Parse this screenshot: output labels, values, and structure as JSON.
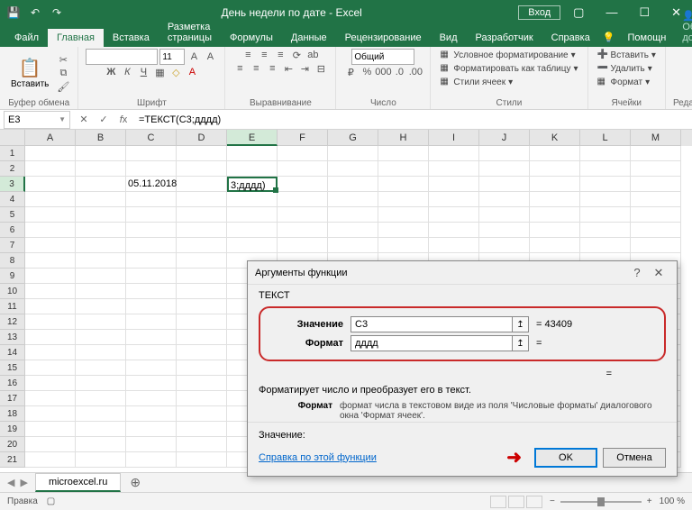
{
  "titlebar": {
    "title": "День недели по дате - Excel",
    "login": "Вход"
  },
  "tabs": {
    "file": "Файл",
    "home": "Главная",
    "insert": "Вставка",
    "layout": "Разметка страницы",
    "formulas": "Формулы",
    "data": "Данные",
    "review": "Рецензирование",
    "view": "Вид",
    "developer": "Разработчик",
    "help": "Справка",
    "tellme": "Помощн",
    "share": "Общий доступ"
  },
  "ribbon": {
    "clipboard": {
      "label": "Буфер обмена",
      "paste": "Вставить"
    },
    "font": {
      "label": "Шрифт",
      "size": "11"
    },
    "alignment": {
      "label": "Выравнивание"
    },
    "number": {
      "label": "Число",
      "format": "Общий"
    },
    "styles": {
      "label": "Стили",
      "cond_format": "Условное форматирование",
      "table_format": "Форматировать как таблицу",
      "cell_styles": "Стили ячеек"
    },
    "cells": {
      "label": "Ячейки",
      "insert": "Вставить",
      "delete": "Удалить",
      "format": "Формат"
    },
    "editing": {
      "label": "Редактирование"
    }
  },
  "formula_bar": {
    "cell_ref": "E3",
    "formula": "=ТЕКСТ(C3;дддд)"
  },
  "grid": {
    "columns": [
      "A",
      "B",
      "C",
      "D",
      "E",
      "F",
      "G",
      "H",
      "I",
      "J",
      "K",
      "L",
      "M"
    ],
    "active_col": "E",
    "active_row": 3,
    "data": {
      "C3": "05.11.2018",
      "E3": "3;дддд)"
    }
  },
  "sheet": {
    "name": "microexcel.ru"
  },
  "status": {
    "mode": "Правка",
    "zoom": "100 %"
  },
  "dialog": {
    "title": "Аргументы функции",
    "func_name": "ТЕКСТ",
    "args": {
      "value_label": "Значение",
      "value_input": "C3",
      "value_result": "= 43409",
      "format_label": "Формат",
      "format_input": "дддд",
      "format_result": "="
    },
    "equals_blank": "=",
    "desc": "Форматирует число и преобразует его в текст.",
    "param_desc_label": "Формат",
    "param_desc_text": "формат числа в текстовом виде из поля 'Числовые форматы' диалогового окна 'Формат ячеек'.",
    "result_label": "Значение:",
    "help_link": "Справка по этой функции",
    "ok": "OK",
    "cancel": "Отмена"
  }
}
